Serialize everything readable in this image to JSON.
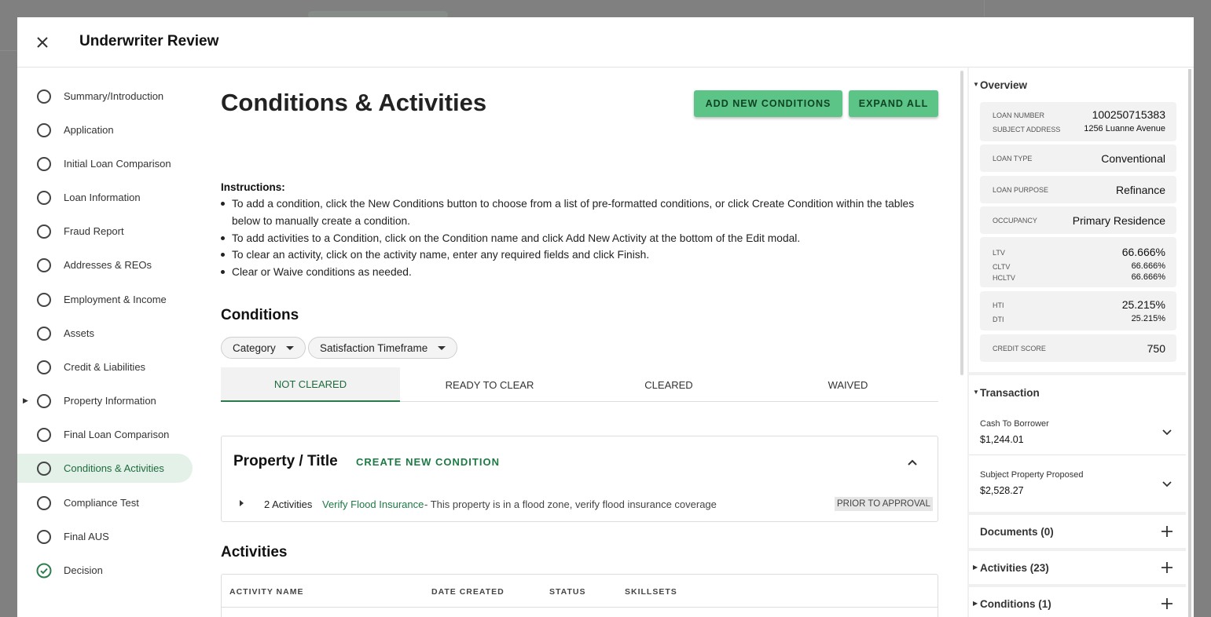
{
  "header": {
    "title": "Underwriter Review"
  },
  "nav": {
    "items": [
      {
        "label": "Summary/Introduction",
        "state": "empty"
      },
      {
        "label": "Application",
        "state": "empty"
      },
      {
        "label": "Initial Loan Comparison",
        "state": "empty"
      },
      {
        "label": "Loan Information",
        "state": "empty"
      },
      {
        "label": "Fraud Report",
        "state": "empty"
      },
      {
        "label": "Addresses & REOs",
        "state": "empty"
      },
      {
        "label": "Employment & Income",
        "state": "empty"
      },
      {
        "label": "Assets",
        "state": "empty"
      },
      {
        "label": "Credit & Liabilities",
        "state": "empty"
      },
      {
        "label": "Property Information",
        "state": "empty",
        "expandable": true
      },
      {
        "label": "Final Loan Comparison",
        "state": "empty"
      },
      {
        "label": "Conditions & Activities",
        "state": "active"
      },
      {
        "label": "Compliance Test",
        "state": "empty"
      },
      {
        "label": "Final AUS",
        "state": "empty"
      },
      {
        "label": "Decision",
        "state": "complete"
      }
    ]
  },
  "main": {
    "title": "Conditions & Activities",
    "add_button": "ADD NEW CONDITIONS",
    "expand_button": "EXPAND ALL",
    "instructions_title": "Instructions:",
    "instructions": [
      "To add a condition, click the New Conditions button to choose from a list of pre-formatted conditions, or click Create Condition within the tables below to manually create a condition.",
      "To add activities to a Condition, click on the Condition name and click Add New Activity at the bottom of the Edit modal.",
      "To clear an activity, click on the activity name, enter any required fields and click Finish.",
      "Clear or Waive conditions as needed."
    ],
    "conditions_heading": "Conditions",
    "filters": [
      "Category",
      "Satisfaction Timeframe"
    ],
    "tabs": [
      "NOT CLEARED",
      "READY TO CLEAR",
      "CLEARED",
      "WAIVED"
    ],
    "active_tab": "NOT CLEARED",
    "condition_group": {
      "title": "Property / Title",
      "create_label": "CREATE NEW CONDITION",
      "row": {
        "activities": "2 Activities",
        "name": "Verify Flood Insurance",
        "description": "- This property is in a flood zone, verify flood insurance coverage",
        "badge": "PRIOR TO APPROVAL"
      }
    },
    "activities_heading": "Activities",
    "activity_columns": [
      "ACTIVITY NAME",
      "DATE CREATED",
      "STATUS",
      "SKILLSETS"
    ]
  },
  "overview": {
    "heading": "Overview",
    "loan_number_label": "LOAN NUMBER",
    "loan_number": "100250715383",
    "subject_address_label": "SUBJECT ADDRESS",
    "subject_address": "1256 Luanne Avenue",
    "loan_type_label": "LOAN TYPE",
    "loan_type": "Conventional",
    "loan_purpose_label": "LOAN PURPOSE",
    "loan_purpose": "Refinance",
    "occupancy_label": "OCCUPANCY",
    "occupancy": "Primary Residence",
    "ltv_label": "LTV",
    "ltv": "66.666%",
    "cltv_label": "CLTV",
    "cltv": "66.666%",
    "hcltv_label": "HCLTV",
    "hcltv": "66.666%",
    "hti_label": "HTI",
    "hti": "25.215%",
    "dti_label": "DTI",
    "dti": "25.215%",
    "credit_score_label": "CREDIT SCORE",
    "credit_score": "750"
  },
  "transaction": {
    "heading": "Transaction",
    "cash_label": "Cash To Borrower",
    "cash_value": "$1,244.01",
    "subject_label": "Subject Property Proposed",
    "subject_value": "$2,528.27"
  },
  "side_sections": {
    "documents": "Documents (0)",
    "activities": "Activities (23)",
    "conditions": "Conditions (1)"
  },
  "colors": {
    "accent": "#5cc486",
    "accent_dark": "#1e7a45",
    "active_nav_bg": "#e3f1e8"
  }
}
